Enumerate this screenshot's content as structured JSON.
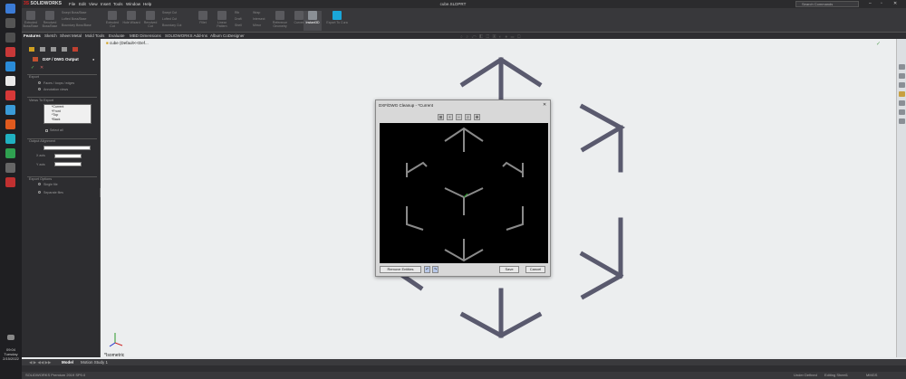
{
  "app": {
    "logo": "SOLIDWORKS",
    "document_title": "cube.SLDPRT",
    "search_placeholder": "Search Commands",
    "menu": [
      "File",
      "Edit",
      "View",
      "Insert",
      "Tools",
      "Window",
      "Help"
    ]
  },
  "ribbon": {
    "buttons": [
      "Extruded Boss/Base",
      "Revolved Boss/Base",
      "Swept Boss/Base",
      "Lofted Boss/Base",
      "Boundary Boss/Base",
      "Extruded Cut",
      "Hole Wizard",
      "Revolved Cut",
      "Swept Cut",
      "Lofted Cut",
      "Boundary Cut",
      "Fillet",
      "Linear Pattern",
      "Rib",
      "Draft",
      "Shell",
      "Wrap",
      "Intersect",
      "Mirror",
      "Reference Geometry",
      "Curves",
      "Instant3D",
      "Export To Cura"
    ]
  },
  "tabs": [
    "Features",
    "Sketch",
    "Sheet Metal",
    "Mold Tools",
    "Evaluate",
    "MBD Dimensions",
    "SOLIDWORKS Add-Ins",
    "Album CoDesigner"
  ],
  "property_manager": {
    "title": "DXF / DWG Output",
    "export_section": "Export",
    "export_options": [
      "Faces / loops / edges",
      "Annotation views"
    ],
    "views_section": "Views To Export",
    "views": [
      "*Current",
      "*Front",
      "*Top",
      "*Back"
    ],
    "select_all": "Select all",
    "alignment_section": "Output Alignment",
    "x_axis": "X axis",
    "y_axis": "Y axis",
    "options_section": "Export Options",
    "export_radio": [
      "Single file",
      "Separate files"
    ]
  },
  "viewport": {
    "breadcrumb": "cube (Default<<Def...",
    "view_label": "*Isometric"
  },
  "dialog": {
    "title": "DXF/DWG Cleanup - *Current",
    "close": "✕",
    "remove_button": "Remove Entities",
    "save_button": "Save",
    "cancel_button": "Cancel"
  },
  "bottom_tabs": [
    "Model",
    "Motion Study 1"
  ],
  "status": {
    "left": "SOLIDWORKS Premium 2019 SP0.0",
    "state": "Under Defined",
    "sheet": "Editing Sheet1",
    "units": "MMGS"
  },
  "clock": {
    "time": "09:04",
    "day": "Tuesday",
    "date": "2/15/2022"
  },
  "colors": {
    "accent_red": "#d22222",
    "preview_bg": "#000000",
    "model_color": "#5a5a6e"
  }
}
